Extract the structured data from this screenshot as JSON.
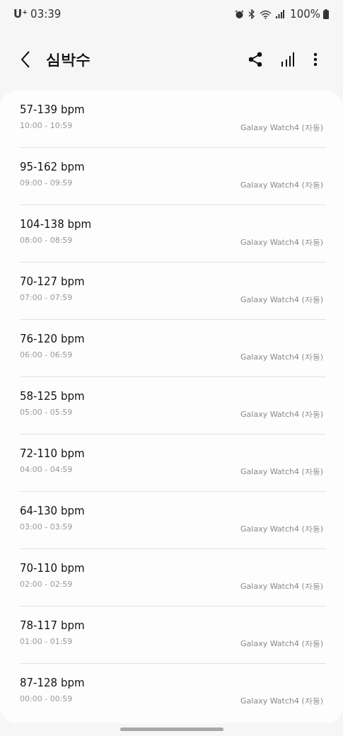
{
  "status_bar": {
    "carrier": "U⁺",
    "time": "03:39",
    "battery": "100%"
  },
  "header": {
    "title": "심박수"
  },
  "records": [
    {
      "range": "57-139 bpm",
      "time": "10:00 - 10:59",
      "source": "Galaxy Watch4 (자동)"
    },
    {
      "range": "95-162 bpm",
      "time": "09:00 - 09:59",
      "source": "Galaxy Watch4 (자동)"
    },
    {
      "range": "104-138 bpm",
      "time": "08:00 - 08:59",
      "source": "Galaxy Watch4 (자동)"
    },
    {
      "range": "70-127 bpm",
      "time": "07:00 - 07:59",
      "source": "Galaxy Watch4 (자동)"
    },
    {
      "range": "76-120 bpm",
      "time": "06:00 - 06:59",
      "source": "Galaxy Watch4 (자동)"
    },
    {
      "range": "58-125 bpm",
      "time": "05:00 - 05:59",
      "source": "Galaxy Watch4 (자동)"
    },
    {
      "range": "72-110 bpm",
      "time": "04:00 - 04:59",
      "source": "Galaxy Watch4 (자동)"
    },
    {
      "range": "64-130 bpm",
      "time": "03:00 - 03:59",
      "source": "Galaxy Watch4 (자동)"
    },
    {
      "range": "70-110 bpm",
      "time": "02:00 - 02:59",
      "source": "Galaxy Watch4 (자동)"
    },
    {
      "range": "78-117 bpm",
      "time": "01:00 - 01:59",
      "source": "Galaxy Watch4 (자동)"
    },
    {
      "range": "87-128 bpm",
      "time": "00:00 - 00:59",
      "source": "Galaxy Watch4 (자동)"
    }
  ]
}
